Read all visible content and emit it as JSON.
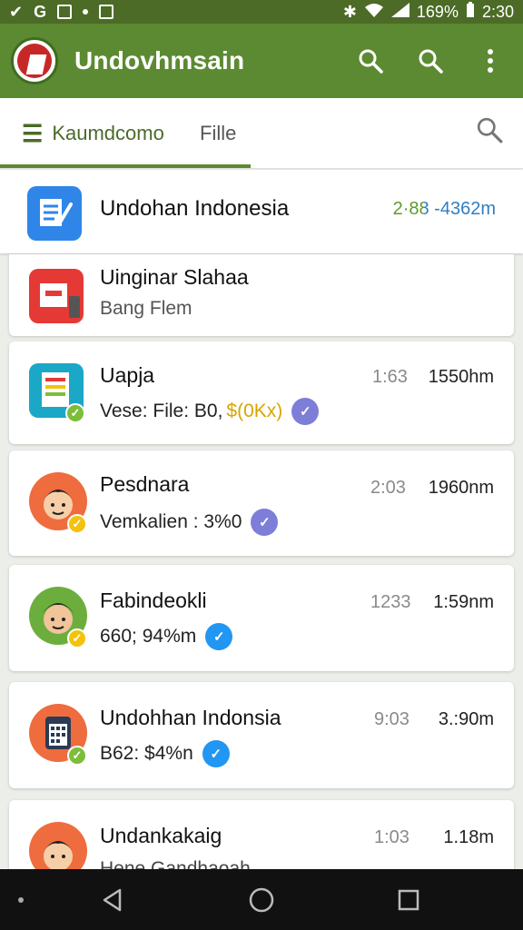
{
  "status_bar": {
    "battery": "169%",
    "time": "2:30"
  },
  "app_bar": {
    "title": "Undovhmsain"
  },
  "tabs": {
    "home_label": "Kaumdcomo",
    "file_label": "Fille"
  },
  "pinned": {
    "title": "Undohan Indonesia",
    "meta": "2·88 -4362m"
  },
  "items": [
    {
      "name": "Uinginar Slahaa",
      "subtitle": "Bang Flem"
    },
    {
      "name": "Uapja",
      "subtitle": "Vese: File: B0,",
      "highlight": "$(0Kx)",
      "meta1": "1:63",
      "meta2": "1550hm"
    },
    {
      "name": "Pesdnara",
      "subtitle": "Vemkalien : 3%0",
      "meta1": "2:03",
      "meta2": "1960nm"
    },
    {
      "name": "Fabindeokli",
      "subtitle": "660; 94%m",
      "meta1": "1233",
      "meta2": "1:59nm"
    },
    {
      "name": "Undohhan Indonsia",
      "subtitle": "B62: $4%n",
      "meta1": "9:03",
      "meta2": "3.:90m"
    },
    {
      "name": "Undankakaig",
      "subtitle": "Hene Gandhaoah",
      "meta1": "1:03",
      "meta2": "1.18m"
    }
  ],
  "colors": {
    "primary": "#5c8a32",
    "status_bar": "#4b6b26",
    "accent_blue": "#2196f3",
    "accent_purple": "#7d7ed8",
    "check_green": "#7cbd3a",
    "check_yellow": "#f4c20d"
  }
}
